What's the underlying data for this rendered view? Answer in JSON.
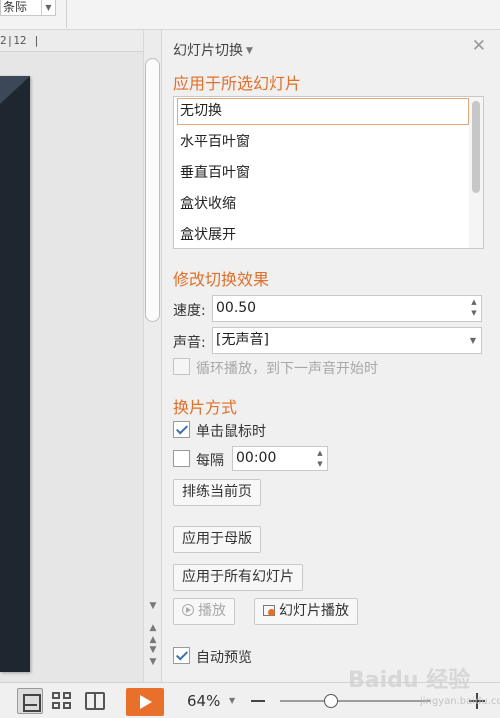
{
  "toolbar": {
    "combo_value": "条际"
  },
  "ruler": {
    "label": "2|12 |"
  },
  "pane": {
    "title": "幻灯片切换",
    "section_apply": "应用于所选幻灯片",
    "transitions": [
      "无切换",
      "水平百叶窗",
      "垂直百叶窗",
      "盒状收缩",
      "盒状展开"
    ],
    "section_modify": "修改切换效果",
    "speed_label": "速度:",
    "speed_value": "00.50",
    "sound_label": "声音:",
    "sound_value": "[无声音]",
    "loop_label": "循环播放，到下一声音开始时",
    "section_advance": "换片方式",
    "on_click_label": "单击鼠标时",
    "on_click_checked": true,
    "interval_label": "每隔",
    "interval_value": "00:00",
    "interval_checked": false,
    "rehearse_button": "排练当前页",
    "apply_master_button": "应用于母版",
    "apply_all_button": "应用于所有幻灯片",
    "play_button": "播放",
    "slideshow_button": "幻灯片播放",
    "auto_preview_label": "自动预览",
    "auto_preview_checked": true
  },
  "status": {
    "zoom": "64%",
    "zoom_level_fraction": 0.3
  },
  "watermark": {
    "text": "Baidu 经验",
    "sub": "jingyan.baidu.com"
  },
  "colors": {
    "accent": "#e0702a",
    "play": "#e8702b",
    "slide_bg": "#1e2630"
  }
}
